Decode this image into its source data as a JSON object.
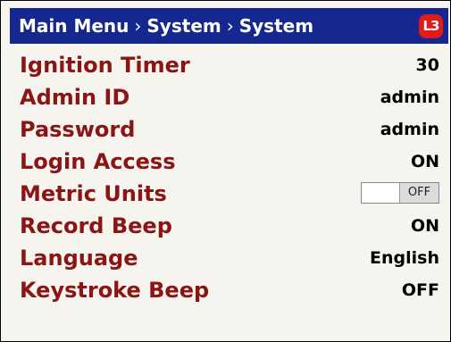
{
  "header": {
    "crumbs": [
      "Main Menu",
      "System",
      "System"
    ],
    "separator": "›",
    "logo": "L3",
    "background_color": "#15288f"
  },
  "settings": [
    {
      "label": "Ignition Timer",
      "value": "30"
    },
    {
      "label": "Admin ID",
      "value": "admin"
    },
    {
      "label": "Password",
      "value": "admin"
    },
    {
      "label": "Login Access",
      "value": "ON"
    },
    {
      "label": "Metric Units",
      "value": "OFF",
      "control": "toggle"
    },
    {
      "label": "Record Beep",
      "value": "ON"
    },
    {
      "label": "Language",
      "value": "English"
    },
    {
      "label": "Keystroke Beep",
      "value": "OFF"
    }
  ],
  "colors": {
    "label": "#8b1414",
    "background": "#f5f4ee"
  }
}
